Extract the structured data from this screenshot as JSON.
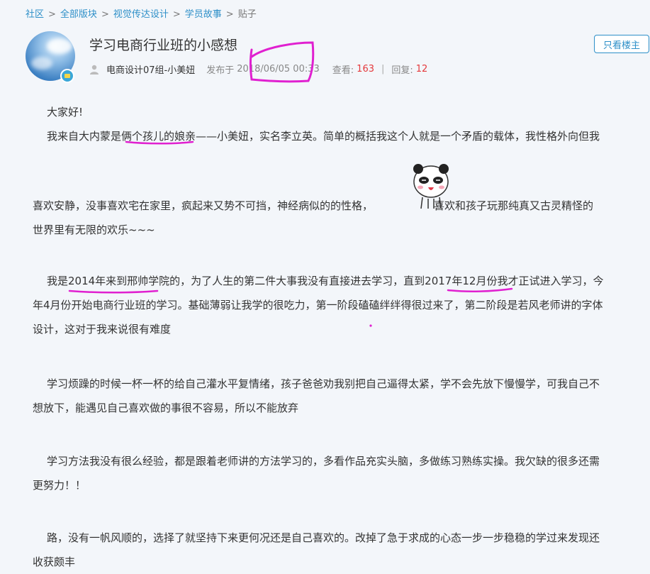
{
  "breadcrumb": {
    "items": [
      "社区",
      "全部版块",
      "视觉传达设计",
      "学员故事"
    ],
    "separator": ">",
    "current": "贴子"
  },
  "post": {
    "title": "学习电商行业班的小感想",
    "author": "电商设计07组-小美妞",
    "posted_label": "发布于",
    "posted_at": "2018/06/05 00:33",
    "views_label": "查看:",
    "views": "163",
    "replies_label": "回复:",
    "replies": "12",
    "divider": "|"
  },
  "actions": {
    "only_op": "只看楼主"
  },
  "content": {
    "greeting": "大家好!",
    "p1_line1": "我来自大内蒙是俩个孩儿的娘亲——小美妞，实名李立英。简单的概括我这个人就是一个矛盾的载体，我性格外向但我",
    "p1_line2a": "喜欢安静，没事喜欢宅在家里，疯起来又势不可挡，神经病似的的性格，",
    "p1_line2b": "喜欢和孩子玩那纯真又古灵精怪的",
    "p1_line3": "世界里有无限的欢乐~~~",
    "p2_line1": "我是2014年来到邢帅学院的，为了人生的第二件大事我没有直接进去学习，直到2017年12月份我才正试进入学习，今",
    "p2_line2": "年4月份开始电商行业班的学习。基础薄弱让我学的很吃力，第一阶段磕磕绊绊得很过来了，第二阶段是若风老师讲的字体",
    "p2_line3": "设计，这对于我来说很有难度",
    "p3_line1": "学习烦躁的时候一杯一杯的给自己灌水平复情绪，孩子爸爸劝我别把自己逼得太紧，学不会先放下慢慢学，可我自己不",
    "p3_line2": "想放下，能遇见自己喜欢做的事很不容易，所以不能放弃",
    "p4_line1": "学习方法我没有很么经验，都是跟着老师讲的方法学习的，多看作品充实头脑，多做练习熟练实操。我欠缺的很多还需",
    "p4_line2": "更努力！！",
    "p5_line1": "路，没有一帆风顺的，选择了就坚持下来更何况还是自己喜欢的。改掉了急于求成的心态一步一步稳稳的学过来发现还",
    "p5_line2": "收获颇丰"
  },
  "icons": {
    "avatar": "avatar-sky-photo",
    "badge": "vip-badge-icon",
    "user": "user-icon",
    "emoji": "panda-emoji-sticker"
  },
  "colors": {
    "link": "#2d8fc8",
    "count": "#e4393c",
    "annotation": "#e020d0",
    "background": "#f3f6fa"
  }
}
